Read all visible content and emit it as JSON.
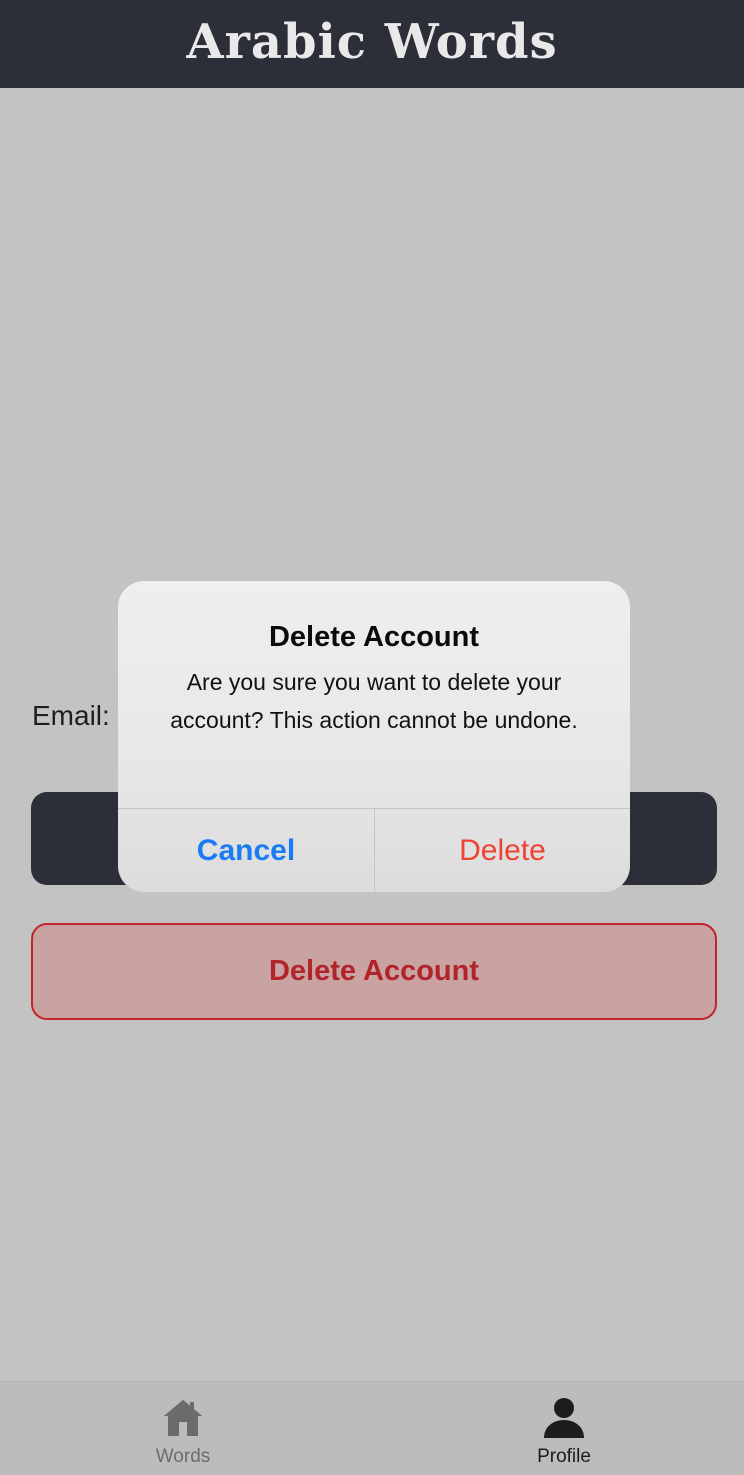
{
  "header": {
    "title": "Arabic Words"
  },
  "profile": {
    "email_label": "Email:",
    "delete_account_label": "Delete Account"
  },
  "dialog": {
    "title": "Delete Account",
    "message": "Are you sure you want to delete your account? This action cannot be undone.",
    "cancel_label": "Cancel",
    "delete_label": "Delete"
  },
  "tabbar": {
    "tabs": [
      {
        "label": "Words",
        "icon": "home-icon",
        "active": false
      },
      {
        "label": "Profile",
        "icon": "person-icon",
        "active": true
      }
    ]
  },
  "colors": {
    "header_bg": "#2c2f37",
    "background": "#c3c3c3",
    "destructive": "#b1252a",
    "link_blue": "#1a7cf5",
    "delete_red": "#ef4233"
  }
}
